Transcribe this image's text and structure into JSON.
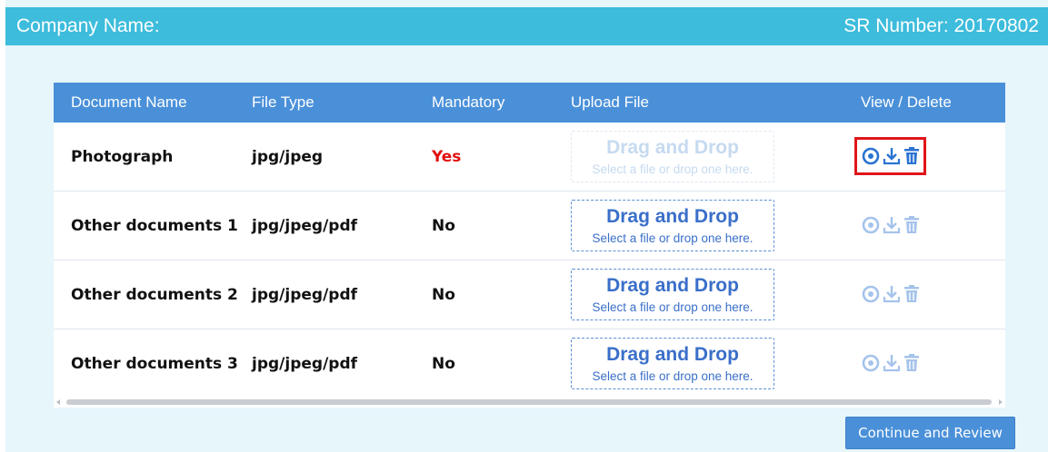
{
  "header": {
    "company_label": "Company Name:",
    "sr_number": "SR Number: 20170802"
  },
  "table": {
    "columns": [
      "Document Name",
      "File Type",
      "Mandatory",
      "Upload File",
      "View / Delete"
    ],
    "rows": [
      {
        "name": "Photograph",
        "file_type": "jpg/jpeg",
        "mandatory": "Yes",
        "drop_title": "Drag and Drop",
        "drop_sub": "Select a file or drop one here."
      },
      {
        "name": "Other documents 1",
        "file_type": "jpg/jpeg/pdf",
        "mandatory": "No",
        "drop_title": "Drag and Drop",
        "drop_sub": "Select a file or drop one here."
      },
      {
        "name": "Other documents 2",
        "file_type": "jpg/jpeg/pdf",
        "mandatory": "No",
        "drop_title": "Drag and Drop",
        "drop_sub": "Select a file or drop one here."
      },
      {
        "name": "Other documents 3",
        "file_type": "jpg/jpeg/pdf",
        "mandatory": "No",
        "drop_title": "Drag and Drop",
        "drop_sub": "Select a file or drop one here."
      }
    ],
    "row_icons": [
      "view-icon",
      "download-icon",
      "delete-icon"
    ]
  },
  "buttons": {
    "continue_label": "Continue and Review"
  },
  "colors": {
    "header_bg": "#3dbcdc",
    "table_header_bg": "#4a90d9",
    "mandatory_yes": "#e01010",
    "icon_blue": "#2a73d1",
    "highlight": "#e0151b"
  }
}
